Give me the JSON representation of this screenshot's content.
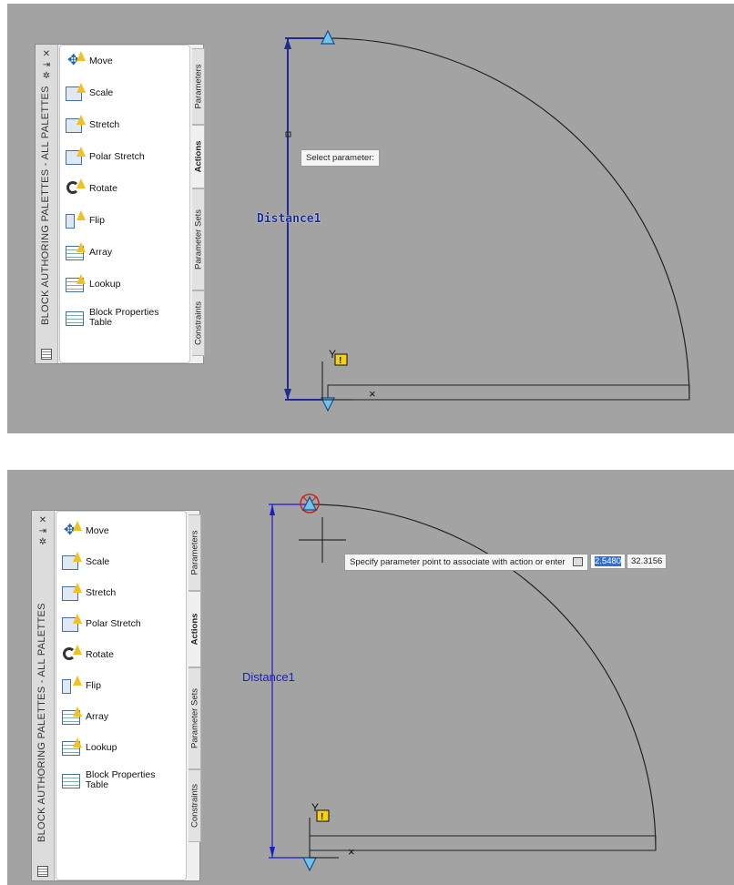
{
  "panels": [
    {
      "palette_title": "BLOCK AUTHORING PALETTES - ALL PALETTES",
      "items": [
        {
          "label": "Move",
          "icon": "move-icon"
        },
        {
          "label": "Scale",
          "icon": "scale-icon"
        },
        {
          "label": "Stretch",
          "icon": "stretch-icon"
        },
        {
          "label": "Polar Stretch",
          "icon": "polar-stretch-icon"
        },
        {
          "label": "Rotate",
          "icon": "rotate-icon"
        },
        {
          "label": "Flip",
          "icon": "flip-icon"
        },
        {
          "label": "Array",
          "icon": "array-icon"
        },
        {
          "label": "Lookup",
          "icon": "lookup-icon"
        },
        {
          "label": "Block Properties Table",
          "icon": "block-properties-table-icon"
        }
      ],
      "tabs": [
        "Parameters",
        "Actions",
        "Parameter Sets",
        "Constraints"
      ],
      "active_tab": "Actions",
      "prompt": "Select parameter:",
      "distance_label": "Distance1",
      "y_label": "Y",
      "colors": {
        "dimension": "#1e2a9a",
        "canvas": "#a3a3a3",
        "warning": "#f3d11b"
      }
    },
    {
      "palette_title": "BLOCK AUTHORING PALETTES - ALL PALETTES",
      "items": [
        {
          "label": "Move",
          "icon": "move-icon"
        },
        {
          "label": "Scale",
          "icon": "scale-icon"
        },
        {
          "label": "Stretch",
          "icon": "stretch-icon"
        },
        {
          "label": "Polar Stretch",
          "icon": "polar-stretch-icon"
        },
        {
          "label": "Rotate",
          "icon": "rotate-icon"
        },
        {
          "label": "Flip",
          "icon": "flip-icon"
        },
        {
          "label": "Array",
          "icon": "array-icon"
        },
        {
          "label": "Lookup",
          "icon": "lookup-icon"
        },
        {
          "label": "Block Properties Table",
          "icon": "block-properties-table-icon"
        }
      ],
      "tabs": [
        "Parameters",
        "Actions",
        "Parameter Sets",
        "Constraints"
      ],
      "active_tab": "Actions",
      "prompt": "Specify parameter point to associate with action or enter",
      "coord_x": "2.5480",
      "coord_y": "32.3156",
      "distance_label": "Distance1",
      "y_label": "Y",
      "colors": {
        "dimension": "#1c1cc8",
        "canvas": "#a3a3a3",
        "warning": "#f3d11b",
        "grip_marker": "#d42020"
      }
    }
  ]
}
